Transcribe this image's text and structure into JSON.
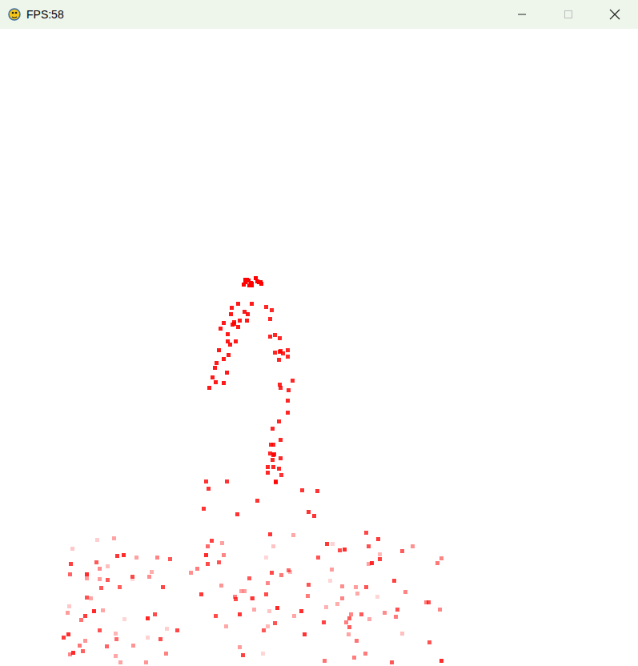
{
  "window": {
    "title": "FPS:58"
  }
}
